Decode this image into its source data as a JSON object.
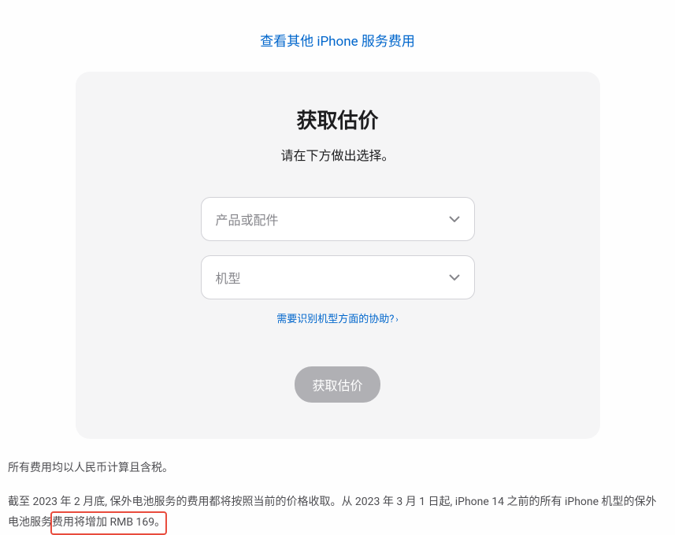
{
  "top_link": {
    "text": "查看其他 iPhone 服务费用"
  },
  "card": {
    "title": "获取估价",
    "subtitle": "请在下方做出选择。",
    "select1": {
      "placeholder": "产品或配件"
    },
    "select2": {
      "placeholder": "机型"
    },
    "help_link": {
      "text": "需要识别机型方面的协助?",
      "arrow": "›"
    },
    "submit_button": "获取估价"
  },
  "footer": {
    "line1": "所有费用均以人民币计算且含税。",
    "line2_a": "截至 2023 年 2 月底, 保外电池服务的费用都将按照当前的价格收取。从 2023 年 3 月 1 日起, iPhone 14 之前的所有 iPhone 机型的保外电池服务",
    "line2_b": "费用将增加 RMB 169。"
  }
}
